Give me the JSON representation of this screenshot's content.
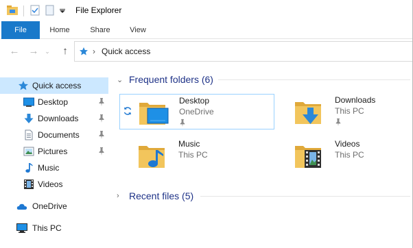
{
  "window": {
    "title": "File Explorer"
  },
  "ribbon": {
    "tabs": [
      {
        "label": "File",
        "active": true
      },
      {
        "label": "Home"
      },
      {
        "label": "Share"
      },
      {
        "label": "View"
      }
    ]
  },
  "address": {
    "path": "Quick access",
    "icon": "star-icon"
  },
  "sidebar": {
    "items": [
      {
        "label": "Quick access",
        "icon": "star-icon",
        "selected": true
      },
      {
        "label": "Desktop",
        "icon": "desktop-icon",
        "pinned": true
      },
      {
        "label": "Downloads",
        "icon": "download-icon",
        "pinned": true
      },
      {
        "label": "Documents",
        "icon": "document-icon",
        "pinned": true
      },
      {
        "label": "Pictures",
        "icon": "pictures-icon",
        "pinned": true
      },
      {
        "label": "Music",
        "icon": "music-icon"
      },
      {
        "label": "Videos",
        "icon": "video-icon"
      },
      {
        "label": "OneDrive",
        "icon": "cloud-icon"
      },
      {
        "label": "This PC",
        "icon": "pc-icon"
      }
    ]
  },
  "groups": {
    "frequent": {
      "title": "Frequent folders (6)",
      "folders": [
        {
          "name": "Desktop",
          "location": "OneDrive",
          "pinned": true,
          "synced": true
        },
        {
          "name": "Downloads",
          "location": "This PC",
          "pinned": true
        },
        {
          "name": "Music",
          "location": "This PC"
        },
        {
          "name": "Videos",
          "location": "This PC"
        }
      ]
    },
    "recent": {
      "title": "Recent files (5)"
    }
  },
  "colors": {
    "accent": "#1979ca",
    "selection": "#cce8ff",
    "group_title": "#1e3287",
    "folder_yellow": "#f2c55c"
  }
}
